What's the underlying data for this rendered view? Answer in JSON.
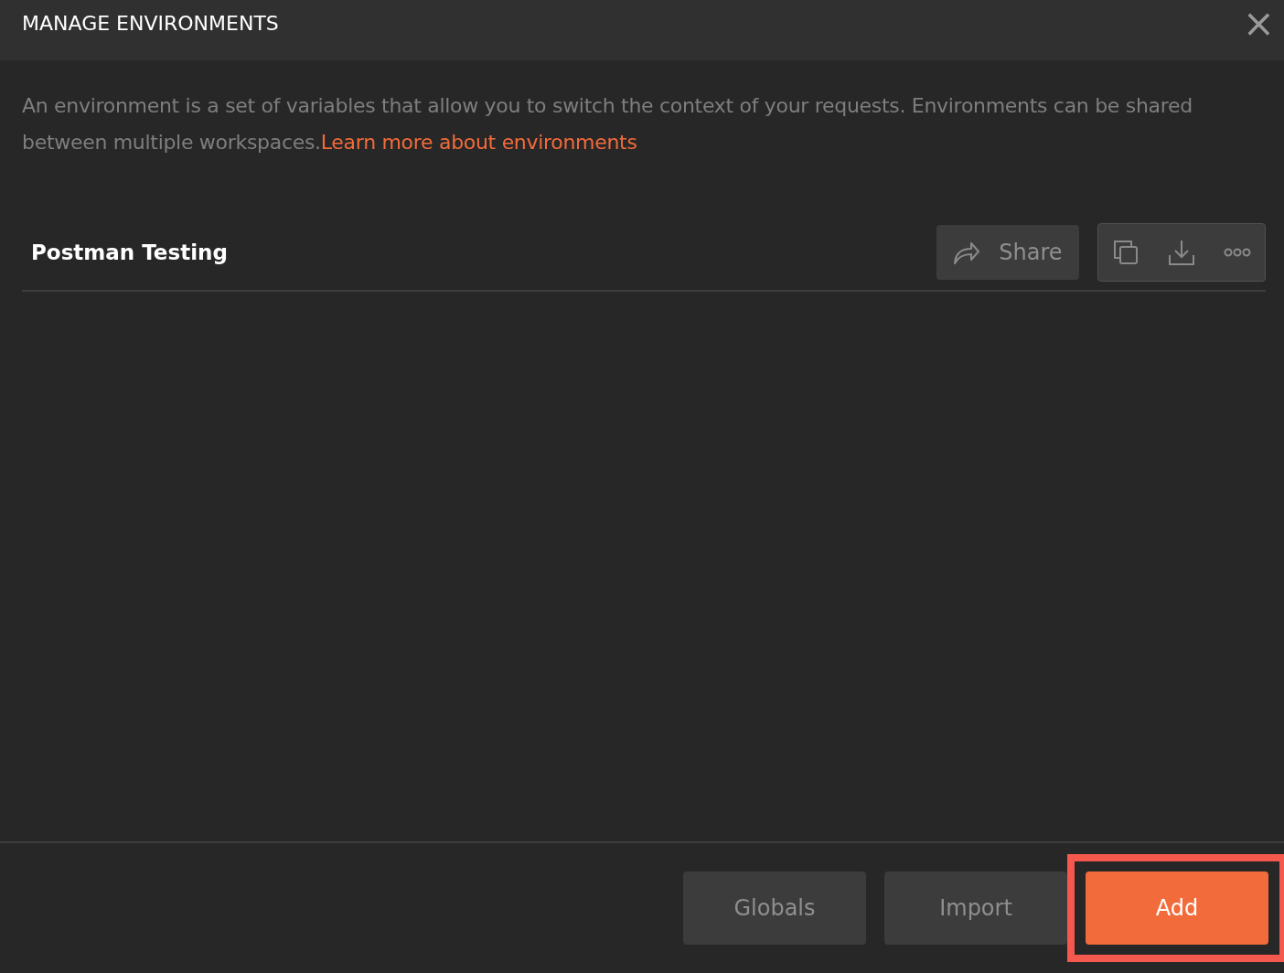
{
  "dialog": {
    "title": "MANAGE ENVIRONMENTS",
    "close": "×"
  },
  "description": {
    "text": "An environment is a set of variables that allow you to switch the context of your requests. Environments can be shared between multiple workspaces.",
    "link": "Learn more about environments"
  },
  "environments": [
    {
      "name": "Postman Testing",
      "share_label": "Share"
    }
  ],
  "footer_buttons": [
    {
      "label": "Globals",
      "kind": "secondary",
      "highlighted": false
    },
    {
      "label": "Import",
      "kind": "secondary",
      "highlighted": false
    },
    {
      "label": "Add",
      "kind": "primary",
      "highlighted": true
    }
  ]
}
